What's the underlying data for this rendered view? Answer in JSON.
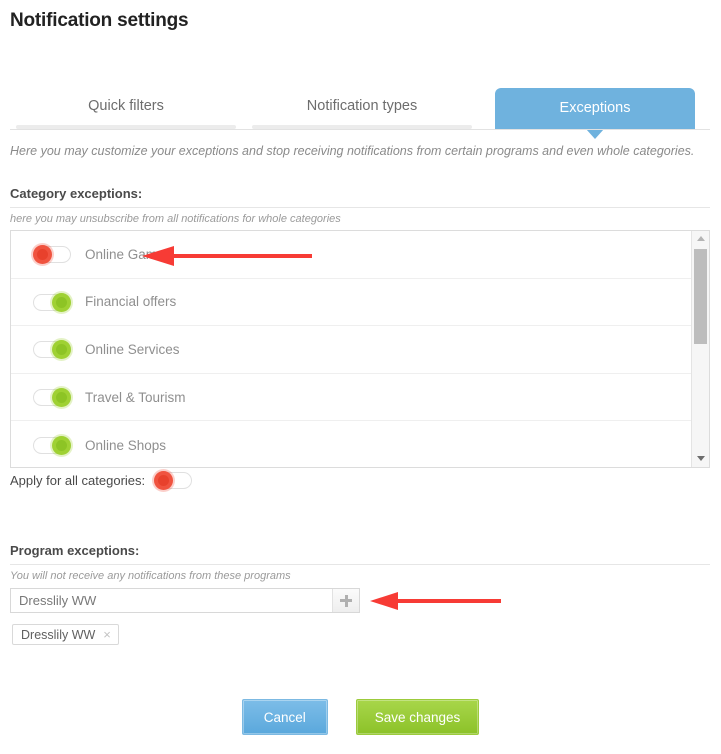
{
  "page": {
    "title": "Notification settings"
  },
  "tabs": [
    {
      "label": "Quick filters",
      "active": false
    },
    {
      "label": "Notification types",
      "active": false
    },
    {
      "label": "Exceptions",
      "active": true
    }
  ],
  "intro_note": "Here you may customize your exceptions and stop receiving notifications from certain programs and even whole categories.",
  "category_section": {
    "heading": "Category exceptions:",
    "subtitle": "here you may unsubscribe from all notifications for whole categories",
    "items": [
      {
        "label": "Online Games",
        "enabled": false
      },
      {
        "label": "Financial offers",
        "enabled": true
      },
      {
        "label": "Online Services",
        "enabled": true
      },
      {
        "label": "Travel & Tourism",
        "enabled": true
      },
      {
        "label": "Online Shops",
        "enabled": true
      }
    ],
    "apply_all_label": "Apply for all categories:",
    "apply_all_enabled": false,
    "scrollbar": {
      "up_icon": "chevron-up-icon",
      "down_icon": "chevron-down-icon"
    }
  },
  "program_section": {
    "heading": "Program exceptions:",
    "subtitle": "You will not receive any notifications from these programs",
    "input_value": "Dresslily WW",
    "input_placeholder": "",
    "add_icon": "plus-icon",
    "tags": [
      {
        "label": "Dresslily WW",
        "remove_icon": "close-icon",
        "remove_glyph": "×"
      }
    ]
  },
  "footer": {
    "cancel_label": "Cancel",
    "save_label": "Save changes"
  },
  "colors": {
    "accent_blue": "#6fb2de",
    "accent_green": "#9fd133",
    "toggle_off_red": "#f0533f",
    "annotation_red": "#f73b35",
    "text_gray": "#8f8f8f"
  },
  "annotations": [
    {
      "name": "arrow-to-online-games-toggle",
      "direction": "left"
    },
    {
      "name": "arrow-to-add-program-button",
      "direction": "left"
    }
  ]
}
